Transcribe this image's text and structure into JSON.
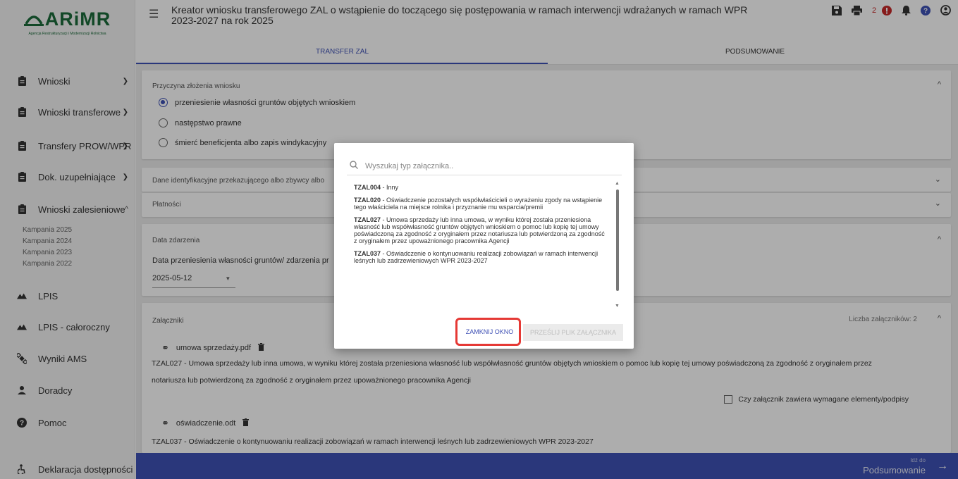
{
  "app": {
    "logo_text": "ARiMR",
    "logo_subtitle": "Agencja Restrukturyzacji i Modernizacji Rolnictwa"
  },
  "sidebar": {
    "items": [
      {
        "label": "Wnioski",
        "icon": "clipboard-icon",
        "chevron": "down"
      },
      {
        "label": "Wnioski transferowe",
        "icon": "clipboard-icon",
        "chevron": "down"
      },
      {
        "label": "Transfery PROW/WPR",
        "icon": "clipboard-icon",
        "chevron": "down"
      },
      {
        "label": "Dok. uzupełniające",
        "icon": "clipboard-icon",
        "chevron": "down"
      },
      {
        "label": "Wnioski zalesieniowe",
        "icon": "clipboard-icon",
        "chevron": "up"
      },
      {
        "label": "LPIS",
        "icon": "terrain-icon"
      },
      {
        "label": "LPIS - całoroczny",
        "icon": "terrain-icon"
      },
      {
        "label": "Wyniki AMS",
        "icon": "satellite-icon"
      },
      {
        "label": "Doradcy",
        "icon": "person-icon"
      },
      {
        "label": "Pomoc",
        "icon": "help-icon"
      },
      {
        "label": "Deklaracja dostępności",
        "icon": "accessibility-icon"
      }
    ],
    "subitems": [
      "Kampania 2025",
      "Kampania 2024",
      "Kampania 2023",
      "Kampania 2022"
    ]
  },
  "header": {
    "title": "Kreator wniosku transferowego ZAL o wstąpienie do toczącego się postępowania w ramach interwencji wdrażanych w ramach WPR 2023-2027 na rok 2025",
    "notification_count": "2",
    "tabs": [
      {
        "label": "TRANSFER ZAL",
        "active": true
      },
      {
        "label": "PODSUMOWANIE",
        "active": false
      }
    ]
  },
  "main": {
    "reason": {
      "label": "Przyczyna złożenia wniosku",
      "options": [
        {
          "label": "przeniesienie własności gruntów objętych wnioskiem",
          "selected": true
        },
        {
          "label": "następstwo prawne",
          "selected": false
        },
        {
          "label": "śmierć beneficjenta albo zapis windykacyjny",
          "selected": false
        }
      ]
    },
    "identification_label": "Dane identyfikacyjne przekazującego albo zbywcy albo",
    "payments_label": "Płatności",
    "event": {
      "label": "Data zdarzenia",
      "field_label": "Data przeniesienia własności gruntów/ zdarzenia pr",
      "date_value": "2025-05-12"
    },
    "attachments": {
      "label": "Załączniki",
      "count_text": "Liczba załączników: 2",
      "files": [
        {
          "name": "umowa sprzedaży.pdf",
          "description_line1": "TZAL027 - Umowa sprzedaży lub inna umowa, w wyniku której została przeniesiona własność lub współwłasność gruntów objętych wnioskiem o pomoc lub kopię tej umowy poświadczoną za zgodność z oryginałem przez",
          "description_line2": "notariusza lub potwierdzoną za zgodność z oryginałem przez upoważnionego pracownika Agencji",
          "checkbox_label": "Czy załącznik zawiera wymagane elementy/podpisy"
        },
        {
          "name": "oświadczenie.odt",
          "description_line1": "TZAL037 - Oświadczenie o kontynuowaniu realizacji zobowiązań w ramach interwencji leśnych lub zadrzewieniowych WPR 2023-2027"
        }
      ]
    }
  },
  "footer": {
    "small": "Idź do",
    "big": "Podsumowanie"
  },
  "dialog": {
    "search_placeholder": "Wyszukaj typ załącznika..",
    "options": [
      {
        "code": "TZAL004",
        "text": " - Inny"
      },
      {
        "code": "TZAL020",
        "text": " - Oświadczenie pozostałych współwłaścicieli o wyrażeniu zgody na wstąpienie tego właściciela na miejsce rolnika i przyznanie mu wsparcia/premii"
      },
      {
        "code": "TZAL027",
        "text": " - Umowa sprzedaży lub inna umowa, w wyniku której została przeniesiona własność lub współwłasność gruntów objętych wnioskiem o pomoc lub kopię tej umowy poświadczoną za zgodność z oryginałem przez notariusza lub potwierdzoną za zgodność z oryginałem przez upoważnionego pracownika Agencji"
      },
      {
        "code": "TZAL037",
        "text": " - Oświadczenie o kontynuowaniu realizacji zobowiązań w ramach interwencji leśnych lub zadrzewieniowych WPR 2023-2027"
      }
    ],
    "close_label": "ZAMKNIJ OKNO",
    "send_label": "PRZEŚLIJ PLIK ZAŁĄCZNIKA"
  },
  "colors": {
    "primary": "#3f51b5",
    "brand_green": "#1b6a3a",
    "highlight_red": "#e53935",
    "alert_red": "#c62828"
  }
}
